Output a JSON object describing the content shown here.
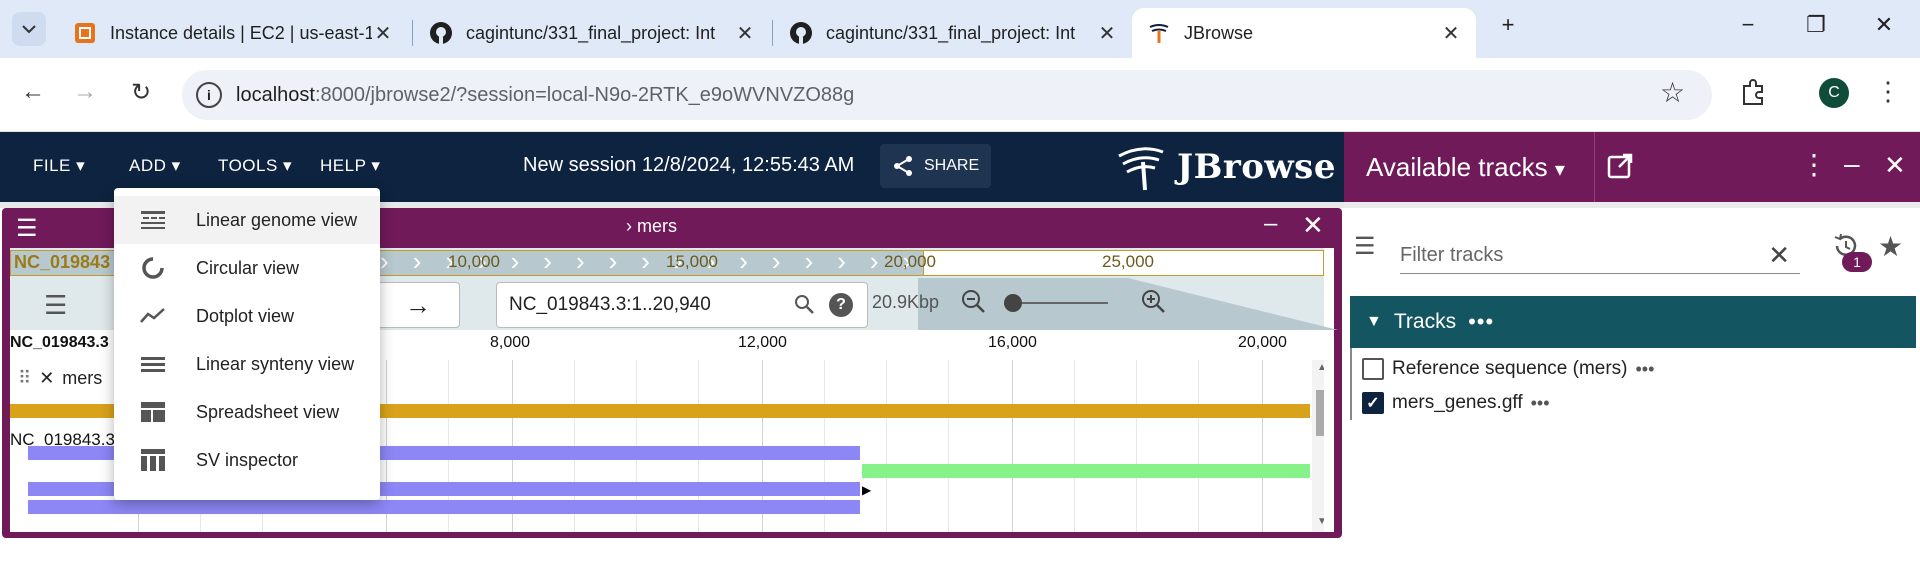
{
  "browser": {
    "tabs": [
      {
        "title": "Instance details | EC2 | us-east-1",
        "icon": "aws-icon"
      },
      {
        "title": "cagintunc/331_final_project: Int",
        "icon": "github-icon"
      },
      {
        "title": "cagintunc/331_final_project: Int",
        "icon": "github-icon"
      },
      {
        "title": "JBrowse",
        "icon": "jbrowse-icon"
      }
    ],
    "url_host": "localhost",
    "url_path": ":8000/jbrowse2/?session=local-N9o-2RTK_e9oWVNVZO88g",
    "avatar_letter": "C"
  },
  "header": {
    "menus": [
      "FILE",
      "ADD",
      "TOOLS",
      "HELP"
    ],
    "session_name": "New session 12/8/2024, 12:55:43 AM",
    "share_label": "SHARE",
    "logo_text": "JBrowse"
  },
  "add_menu": {
    "items": [
      {
        "label": "Linear genome view",
        "icon": "linear-genome-icon"
      },
      {
        "label": "Circular view",
        "icon": "circular-icon"
      },
      {
        "label": "Dotplot view",
        "icon": "dotplot-icon"
      },
      {
        "label": "Linear synteny view",
        "icon": "synteny-icon"
      },
      {
        "label": "Spreadsheet view",
        "icon": "spreadsheet-icon"
      },
      {
        "label": "SV inspector",
        "icon": "sv-inspector-icon"
      }
    ]
  },
  "view": {
    "title": "mers",
    "overview_ref": "NC_019843",
    "overview_ticks": [
      "10,000",
      "15,000",
      "20,000",
      "25,000"
    ],
    "locstring": "NC_019843.3:1..20,940",
    "bp_size": "20.9Kbp",
    "ruler_ref": "NC_019843.3",
    "ruler_ticks": [
      "8,000",
      "12,000",
      "16,000",
      "20,000"
    ],
    "track_label": "mers",
    "track_ref_label": "NC_019843.3"
  },
  "drawer": {
    "title": "Available tracks",
    "filter_placeholder": "Filter tracks",
    "history_badge": "1",
    "category": "Tracks",
    "tracks": [
      {
        "label": "Reference sequence (mers)",
        "checked": false
      },
      {
        "label": "mers_genes.gff",
        "checked": true
      }
    ]
  },
  "colors": {
    "header_bg": "#0d233f",
    "view_frame": "#701a5a",
    "tracks_category": "#135560",
    "sequence_bar": "#d9a21b",
    "feature_blue": "#8c87f5",
    "feature_green": "#88f28a"
  }
}
